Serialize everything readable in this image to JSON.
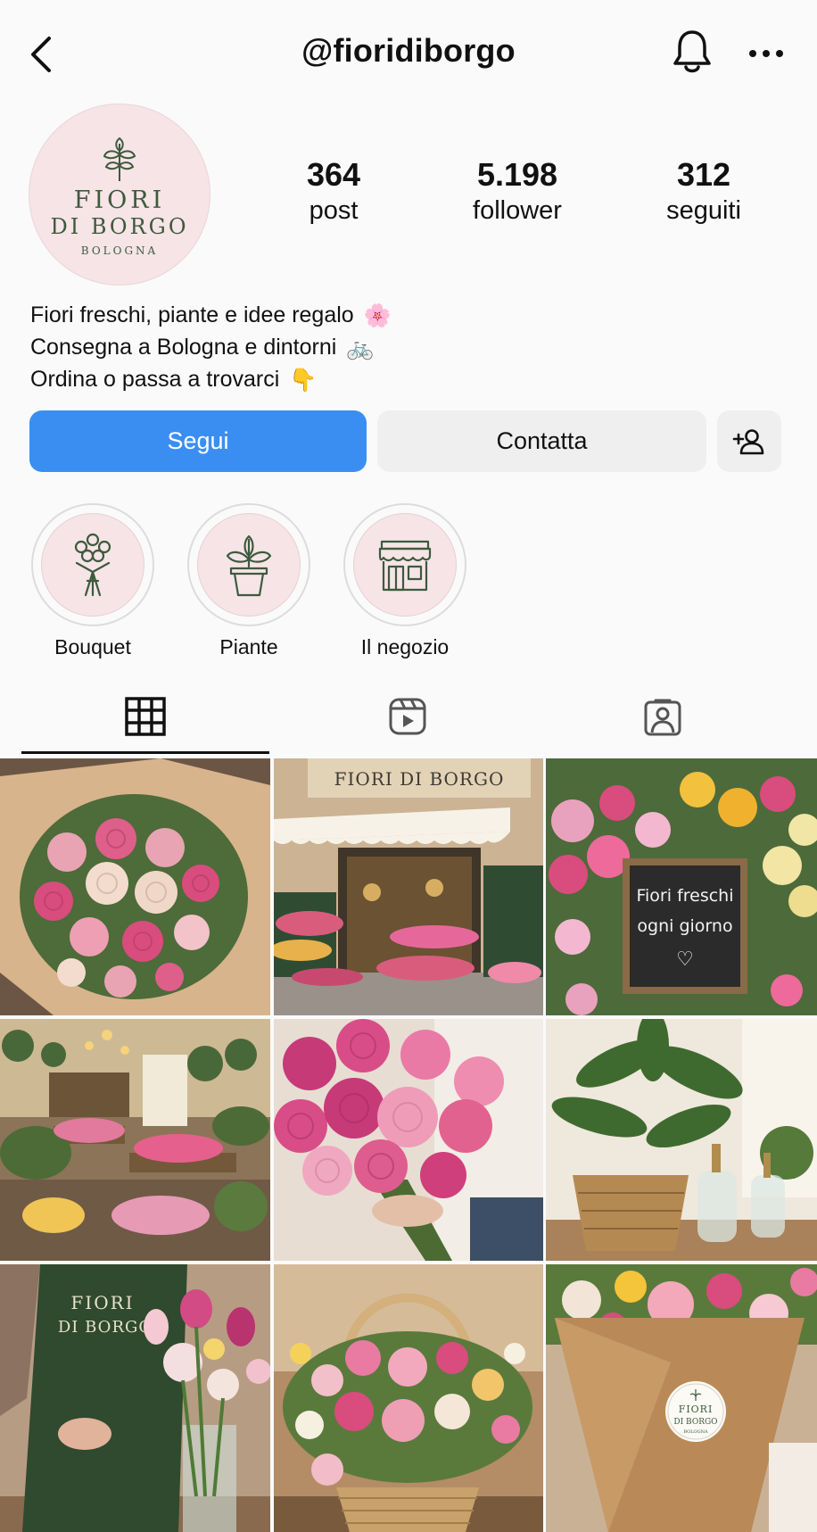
{
  "header": {
    "username": "@fioridiborgo",
    "back_icon": "chevron-left-icon",
    "bell_icon": "bell-icon",
    "more_icon": "more-horizontal-icon"
  },
  "profile": {
    "logo": {
      "line1": "FIORI",
      "line2": "DI BORGO",
      "line3": "BOLOGNA"
    },
    "stats": [
      {
        "value": "364",
        "label": "post"
      },
      {
        "value": "5.198",
        "label": "follower"
      },
      {
        "value": "312",
        "label": "seguiti"
      }
    ],
    "bio": [
      {
        "text": "Fiori freschi, piante e idee regalo",
        "emoji": "🌸"
      },
      {
        "text": "Consegna a Bologna e dintorni",
        "emoji": "🚲"
      },
      {
        "text": "Ordina o passa a trovarci",
        "emoji": "👇"
      }
    ]
  },
  "actions": {
    "follow": "Segui",
    "contact": "Contatta"
  },
  "highlights": [
    {
      "label": "Bouquet",
      "icon": "bouquet-icon"
    },
    {
      "label": "Piante",
      "icon": "potted-plant-icon"
    },
    {
      "label": "Il negozio",
      "icon": "storefront-icon"
    }
  ],
  "tabs": [
    {
      "name": "grid",
      "icon": "grid-icon"
    },
    {
      "name": "reels",
      "icon": "reels-icon"
    },
    {
      "name": "tagged",
      "icon": "tagged-person-icon"
    }
  ],
  "posts": [
    {
      "subject": "pink rose bouquet"
    },
    {
      "subject": "shop storefront",
      "sign": "FIORI DI BORGO"
    },
    {
      "subject": "flowers chalkboard",
      "chalk1": "Fiori freschi",
      "chalk2": "ogni giorno",
      "chalk3": "♡"
    },
    {
      "subject": "shop interior"
    },
    {
      "subject": "peony bouquet"
    },
    {
      "subject": "potted plant"
    },
    {
      "subject": "florist apron",
      "apron1": "FIORI",
      "apron2": "DI BORGO"
    },
    {
      "subject": "flower basket"
    },
    {
      "subject": "wrapped bouquet",
      "sticker1": "FIORI",
      "sticker2": "DI BORGO",
      "sticker3": "BOLOGNA"
    }
  ],
  "colors": {
    "primary": "#3b8ef1",
    "secondary_button": "#efefef",
    "logo_pink": "#f6e4e7",
    "logo_green": "#3d5a3c"
  }
}
